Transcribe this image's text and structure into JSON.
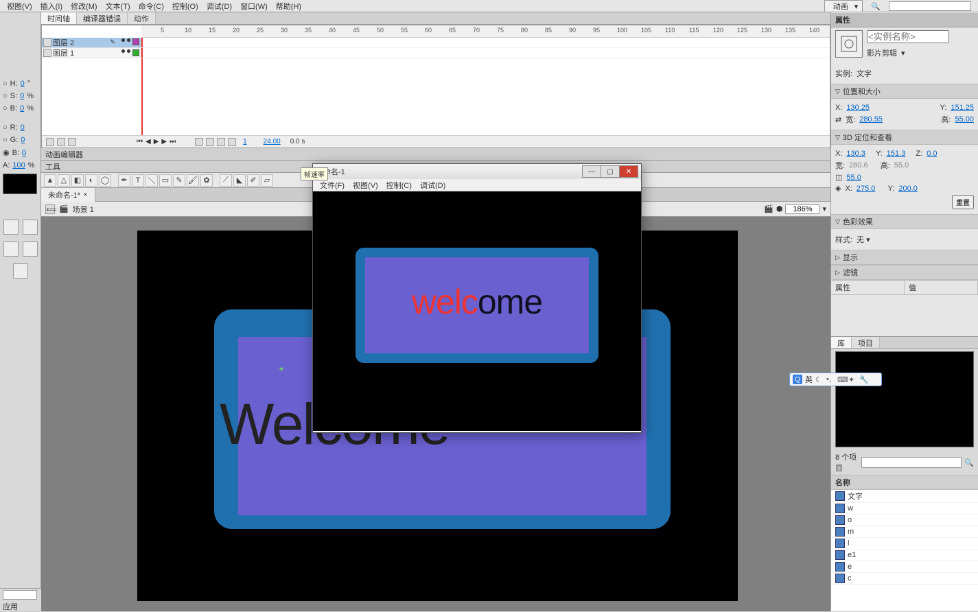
{
  "menus": [
    "视图(V)",
    "插入(I)",
    "修改(M)",
    "文本(T)",
    "命令(C)",
    "控制(O)",
    "调试(D)",
    "窗口(W)",
    "帮助(H)"
  ],
  "workspace": {
    "label": "动画",
    "search_placeholder": ""
  },
  "timeline_tabs": [
    "时间轴",
    "编译器错误",
    "动作"
  ],
  "layers": [
    {
      "name": "图层 2",
      "selected": true,
      "color": "#b040b0"
    },
    {
      "name": "图层 1",
      "selected": false,
      "color": "#30b030"
    }
  ],
  "ruler_max": 140,
  "playback": {
    "frame": "1",
    "fps": "24.00",
    "time": "0.0 s"
  },
  "anim_editor_label": "动画编辑器",
  "tools_label": "工具",
  "doc_tab": "未命名-1*",
  "scene": "场景 1",
  "zoom": "186%",
  "stage_text": "Welcome",
  "left": {
    "H": {
      "label": "H:",
      "val": "0"
    },
    "S": {
      "label": "S:",
      "val": "0"
    },
    "Br": {
      "label": "B:",
      "val": "0"
    },
    "R": {
      "label": "R:",
      "val": "0"
    },
    "G": {
      "label": "G:",
      "val": "0"
    },
    "B": {
      "label": "B:",
      "val": "0"
    },
    "A": {
      "label": "A:",
      "val": "100"
    },
    "deg": "°",
    "pct": "%"
  },
  "bottom_label": "应用",
  "properties": {
    "title": "属性",
    "instance_name_placeholder": "<实例名称>",
    "type": "影片剪辑",
    "instance_of_label": "实例:",
    "instance_of": "文字",
    "pos_size_title": "位置和大小",
    "X": "130.25",
    "Y": "151.25",
    "W_label": "宽:",
    "W": "280.55",
    "H_label": "高:",
    "H": "55.00",
    "pos3d_title": "3D 定位和查看",
    "X3": "130.3",
    "Y3": "151.3",
    "Z3": "0.0",
    "W3": "280.6",
    "H3": "55.0",
    "persp": "55.0",
    "vpx_label": "X:",
    "vpx": "275.0",
    "vpy_label": "Y:",
    "vpy": "200.0",
    "vp_reset": "重置",
    "color_title": "色彩效果",
    "style_label": "样式:",
    "style_value": "无",
    "display_title": "显示",
    "filters_title": "滤镜",
    "table_col1": "属性",
    "table_col2": "值"
  },
  "library": {
    "tabs": [
      "库",
      "项目"
    ],
    "count": "8 个项目",
    "header": "名称",
    "items": [
      "文字",
      "w",
      "o",
      "m",
      "l",
      "e1",
      "e",
      "c"
    ]
  },
  "popup": {
    "title": "未命名-1",
    "menus": [
      "文件(F)",
      "视图(V)",
      "控制(C)",
      "调试(D)"
    ],
    "text_red": "welc",
    "text_black": "ome"
  },
  "tooltip": "帧速率",
  "ime": "英"
}
